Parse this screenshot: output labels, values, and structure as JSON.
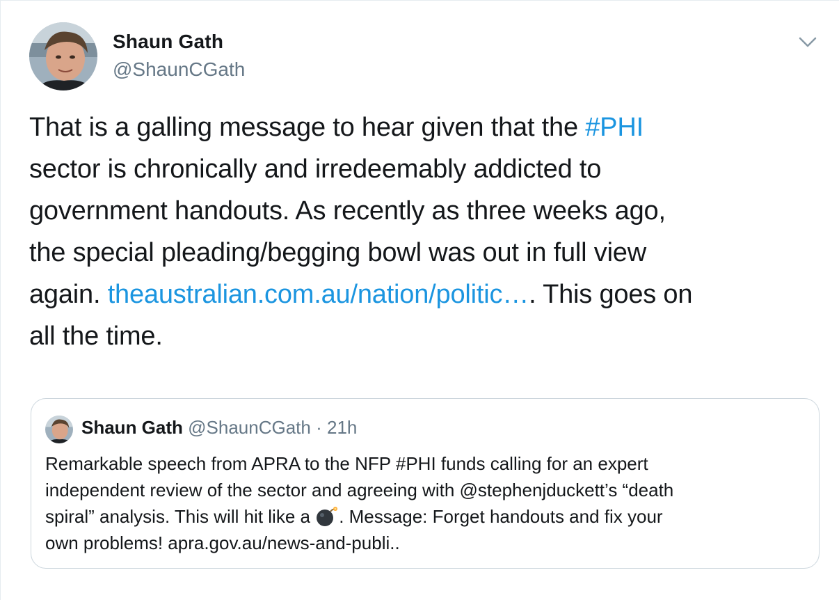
{
  "tweet": {
    "author_name": "Shaun Gath",
    "author_handle": "@ShaunCGath",
    "text": {
      "line1_pre": "That is a galling message to hear given that the ",
      "hashtag": "#PHI",
      "line2": "sector is chronically and irredeemably addicted to",
      "line3": "government handouts. As recently as three weeks ago,",
      "line4": "the special pleading/begging bowl was out in full view",
      "line5_pre": "again. ",
      "link": "theaustralian.com.au/nation/politic…",
      "line5_post": ". This goes on",
      "line6": "all the time."
    },
    "menu_icon": "chevron-down-icon"
  },
  "quoted_tweet": {
    "author_name": "Shaun Gath",
    "author_handle": "@ShaunCGath",
    "separator": "·",
    "time": "21h",
    "text": {
      "line1": "Remarkable speech from APRA to the NFP #PHI funds calling for an expert",
      "line2": "independent review of the sector and agreeing with @stephenjduckett’s “death",
      "line3_pre": "spiral” analysis. This will hit like a ",
      "line3_post": ". Message: Forget handouts and fix your",
      "line4": "own problems!  apra.gov.au/news-and-publi.."
    },
    "emoji": "bomb-icon"
  },
  "colors": {
    "link": "#1b95e0",
    "text": "#14171a",
    "secondary": "#657786",
    "border": "#ccd6dd"
  }
}
